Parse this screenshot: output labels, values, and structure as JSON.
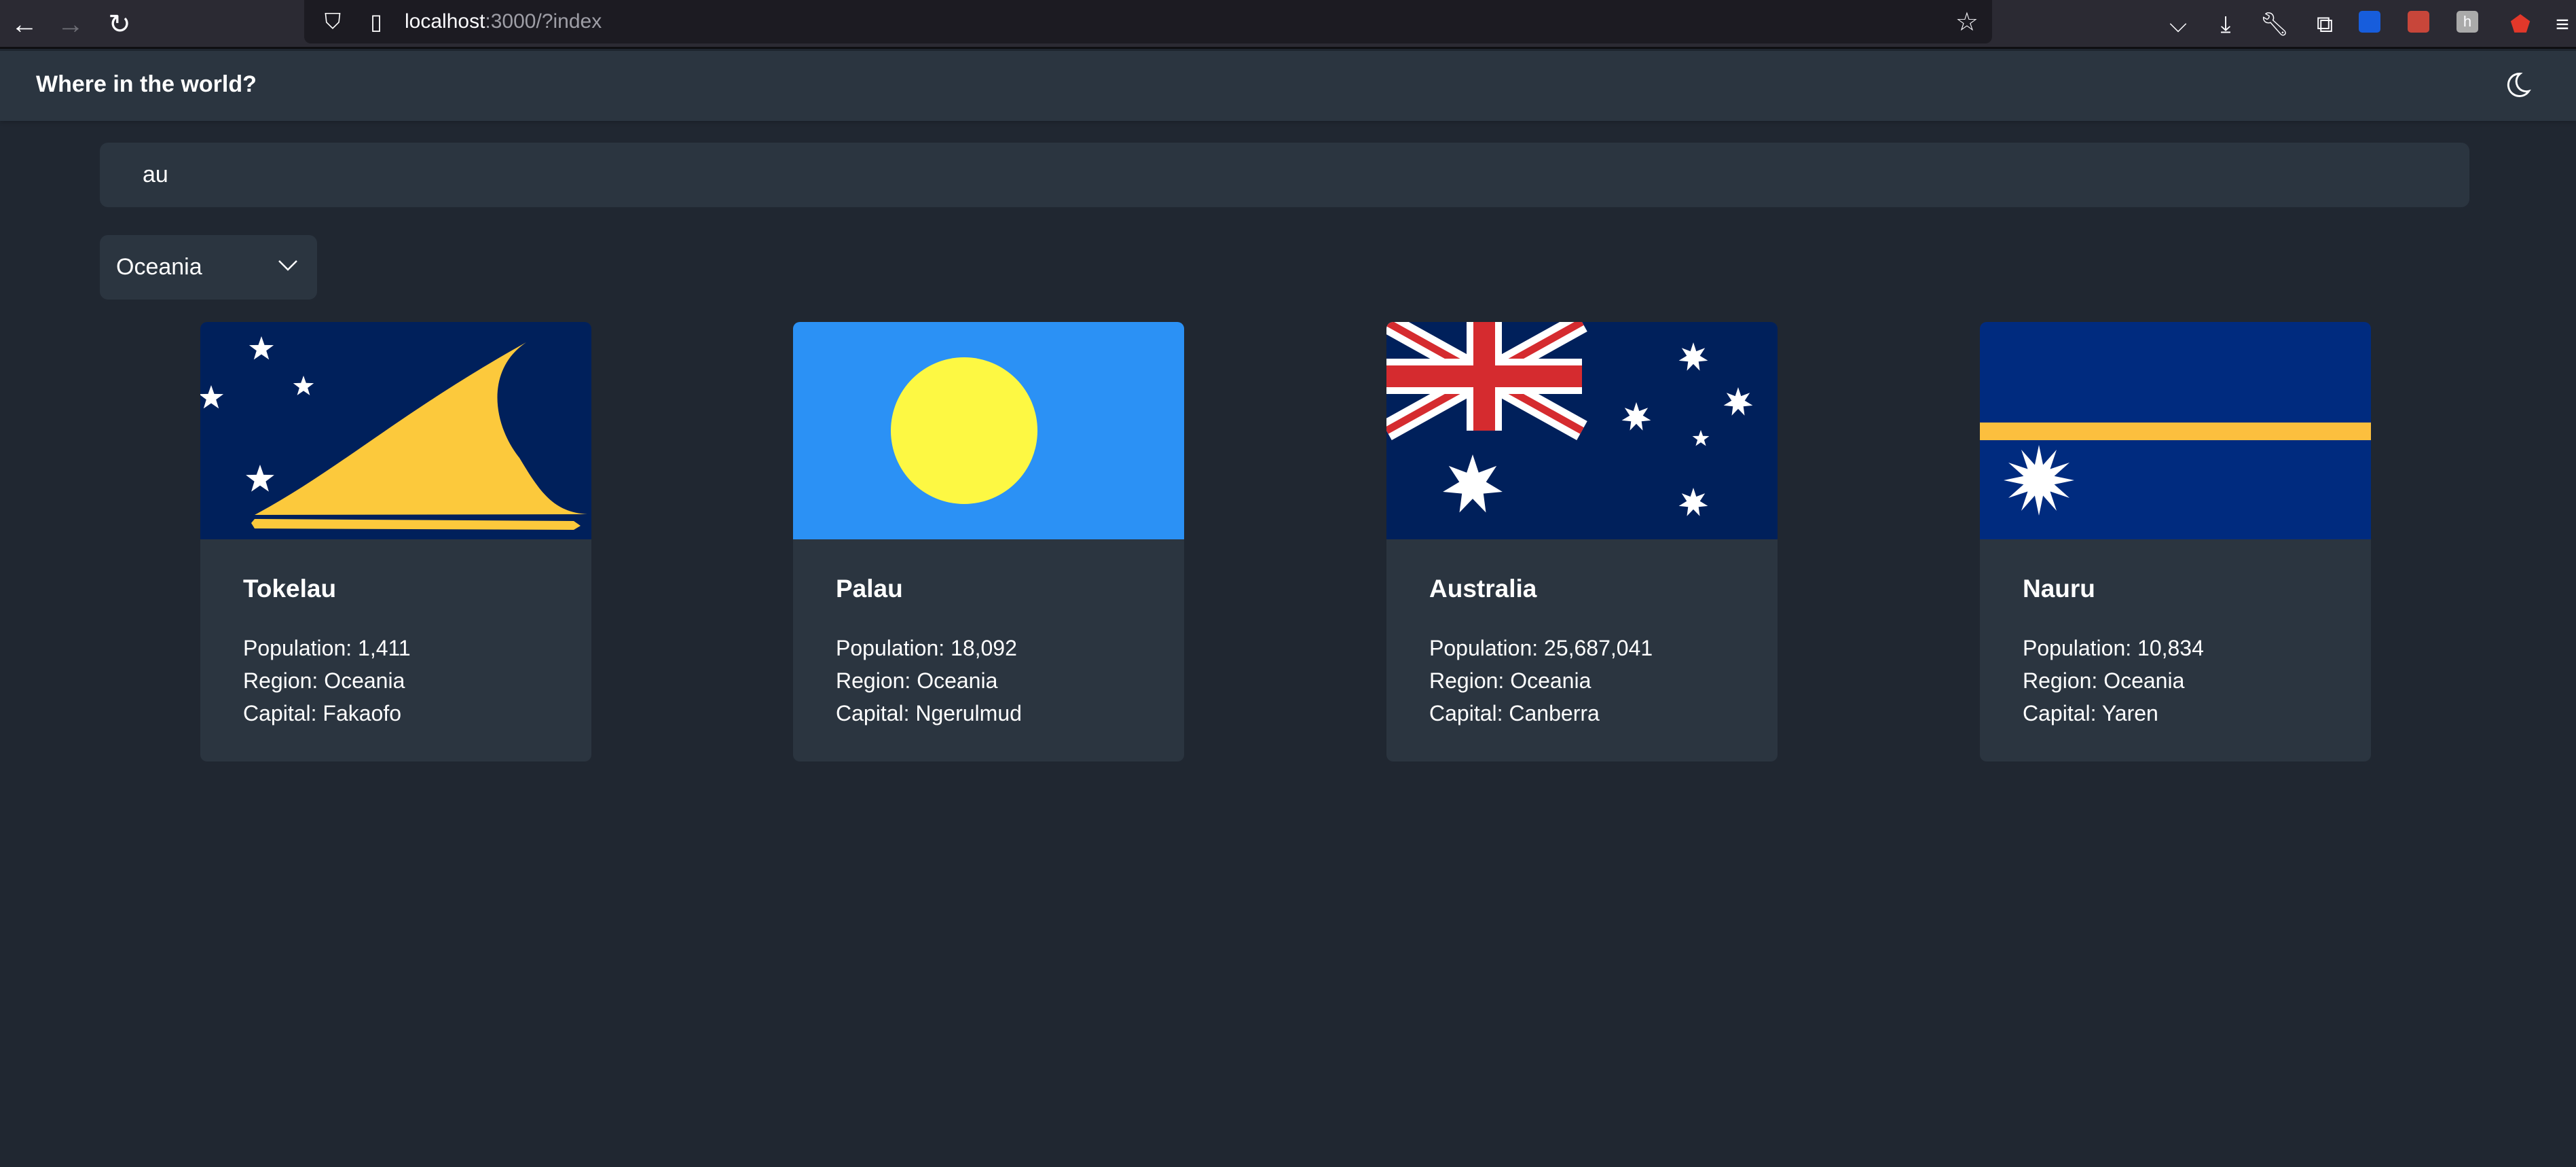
{
  "browser": {
    "url_host": "localhost",
    "url_rest": ":3000/?index",
    "icons": [
      "back-icon",
      "forward-icon",
      "reload-icon",
      "shield-icon",
      "page-icon",
      "bookmark-star-icon",
      "pocket-icon",
      "download-icon",
      "wrench-icon",
      "extensions-icon",
      "bitwarden-icon",
      "react-devtools-icon",
      "honey-icon",
      "privacy-badger-icon",
      "menu-icon"
    ]
  },
  "header": {
    "title": "Where in the world?",
    "theme_icon": "moon-icon"
  },
  "search": {
    "value": "au"
  },
  "filter": {
    "selected": "Oceania"
  },
  "labels": {
    "population": "Population:",
    "region": "Region:",
    "capital": "Capital:"
  },
  "countries": [
    {
      "name": "Tokelau",
      "population": "1,411",
      "region": "Oceania",
      "capital": "Fakaofo"
    },
    {
      "name": "Palau",
      "population": "18,092",
      "region": "Oceania",
      "capital": "Ngerulmud"
    },
    {
      "name": "Australia",
      "population": "25,687,041",
      "region": "Oceania",
      "capital": "Canberra"
    },
    {
      "name": "Nauru",
      "population": "10,834",
      "region": "Oceania",
      "capital": "Yaren"
    }
  ],
  "colors": {
    "bg": "#202731",
    "element": "#2b3540",
    "navy": "#012169",
    "gold": "#fcc93c",
    "palau_blue": "#2b91f5",
    "palau_moon": "#fdf843"
  }
}
